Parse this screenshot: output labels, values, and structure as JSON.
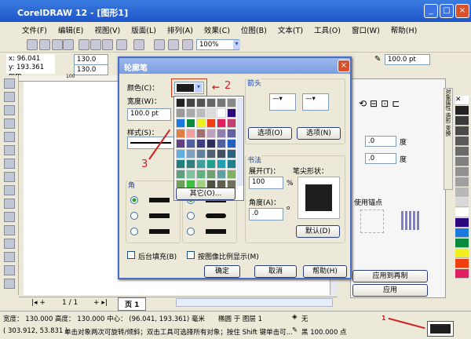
{
  "window": {
    "title": "CorelDRAW 12 - [图形1]",
    "min": "_",
    "max": "□",
    "close": "×"
  },
  "menu": [
    "文件(F)",
    "编辑(E)",
    "视图(V)",
    "版面(L)",
    "排列(A)",
    "效果(C)",
    "位图(B)",
    "文本(T)",
    "工具(O)",
    "窗口(W)",
    "帮助(H)"
  ],
  "toolbar": {
    "zoom": "100%"
  },
  "propbar": {
    "x": "x: 96.041 mm",
    "y": "y: 193.361 mm",
    "w": "130.0 mm",
    "h": "130.0 mm",
    "outline": "100.0 pt",
    "ruler_tick": "100"
  },
  "dialog": {
    "title": "轮廓笔",
    "color_label": "颜色(C)：",
    "width_label": "宽度(W)：",
    "width_value": "100.0 pt",
    "style_label": "样式(S)：",
    "other_button": "其它(O)...",
    "arrows_title": "箭头",
    "options_left": "选项(O)",
    "options_right": "选项(N)",
    "calligraphy_title": "书法",
    "stretch_label": "展开(T)：",
    "stretch_value": "100",
    "percent": "%",
    "nib_label": "笔尖形状：",
    "angle_label": "角度(A)：",
    "angle_value": ".0",
    "degree": "o",
    "default_button": "默认(D)",
    "corners_title": "角",
    "behind_fill": "后台填充(B)",
    "scale_with_image": "按图像比例显示(M)",
    "ok": "确定",
    "cancel": "取消",
    "help": "帮助(H)",
    "current_color": "#1e1e1e",
    "palette": [
      "#222222",
      "#444444",
      "#555555",
      "#666666",
      "#777777",
      "#888888",
      "#999999",
      "#aaaaaa",
      "#bbbbbb",
      "#dddddd",
      "#ffffff",
      "#2a0a7a",
      "#1a7ae0",
      "#0a8a3a",
      "#f0f020",
      "#f04010",
      "#e02060",
      "#c04070",
      "#e08040",
      "#f0a0a0",
      "#a07070",
      "#c0a0c0",
      "#9080b0",
      "#6060a0",
      "#604080",
      "#5060a0",
      "#404080",
      "#303060",
      "#5060a0",
      "#2060c0",
      "#60b0e0",
      "#80a0c0",
      "#6080a0",
      "#506070",
      "#405060",
      "#306080",
      "#208080",
      "#308080",
      "#40a0a0",
      "#20a090",
      "#20a0b0",
      "#208090",
      "#60a080",
      "#80c0a0",
      "#60b080",
      "#70a070",
      "#60a0a0",
      "#80b060",
      "#70a060",
      "#40c040",
      "#a0d080",
      "#505040",
      "#606050",
      "#707060"
    ]
  },
  "annotations": {
    "a2": "2",
    "a3": "3",
    "a1": "1"
  },
  "docker": {
    "deg1": ".0",
    "deg2": ".0",
    "deg_unit": "度",
    "anchor": "使用锚点",
    "apply_dup": "应用到再制",
    "apply": "应用",
    "tabs": [
      "对象属性",
      "造形",
      "变换"
    ]
  },
  "pages": {
    "count": "1 / 1",
    "tab": "页 1"
  },
  "status": {
    "line1": "宽度： 130.000  高度： 130.000  中心： (96.041, 193.361)  毫米",
    "layer": "椭圆 于 图层 1",
    "coords": "( 303.912, 53.831 )",
    "hint": "单击对象两次可旋转/倾斜；双击工具可选择所有对象；按住 Shift 键单击可...",
    "fill": "无",
    "outline": "黑 100.000 点"
  },
  "color_palette": [
    "#ffffff",
    "#222222",
    "#3a3a3a",
    "#4a4a4a",
    "#5a5a5a",
    "#6a6a6a",
    "#808080",
    "#909090",
    "#a0a0a0",
    "#b8b8b8",
    "#d8d8d8",
    "#ffffff",
    "#2a0a7a",
    "#1a7ae0",
    "#0a8a3a",
    "#f0f020",
    "#f04010",
    "#e02060"
  ]
}
